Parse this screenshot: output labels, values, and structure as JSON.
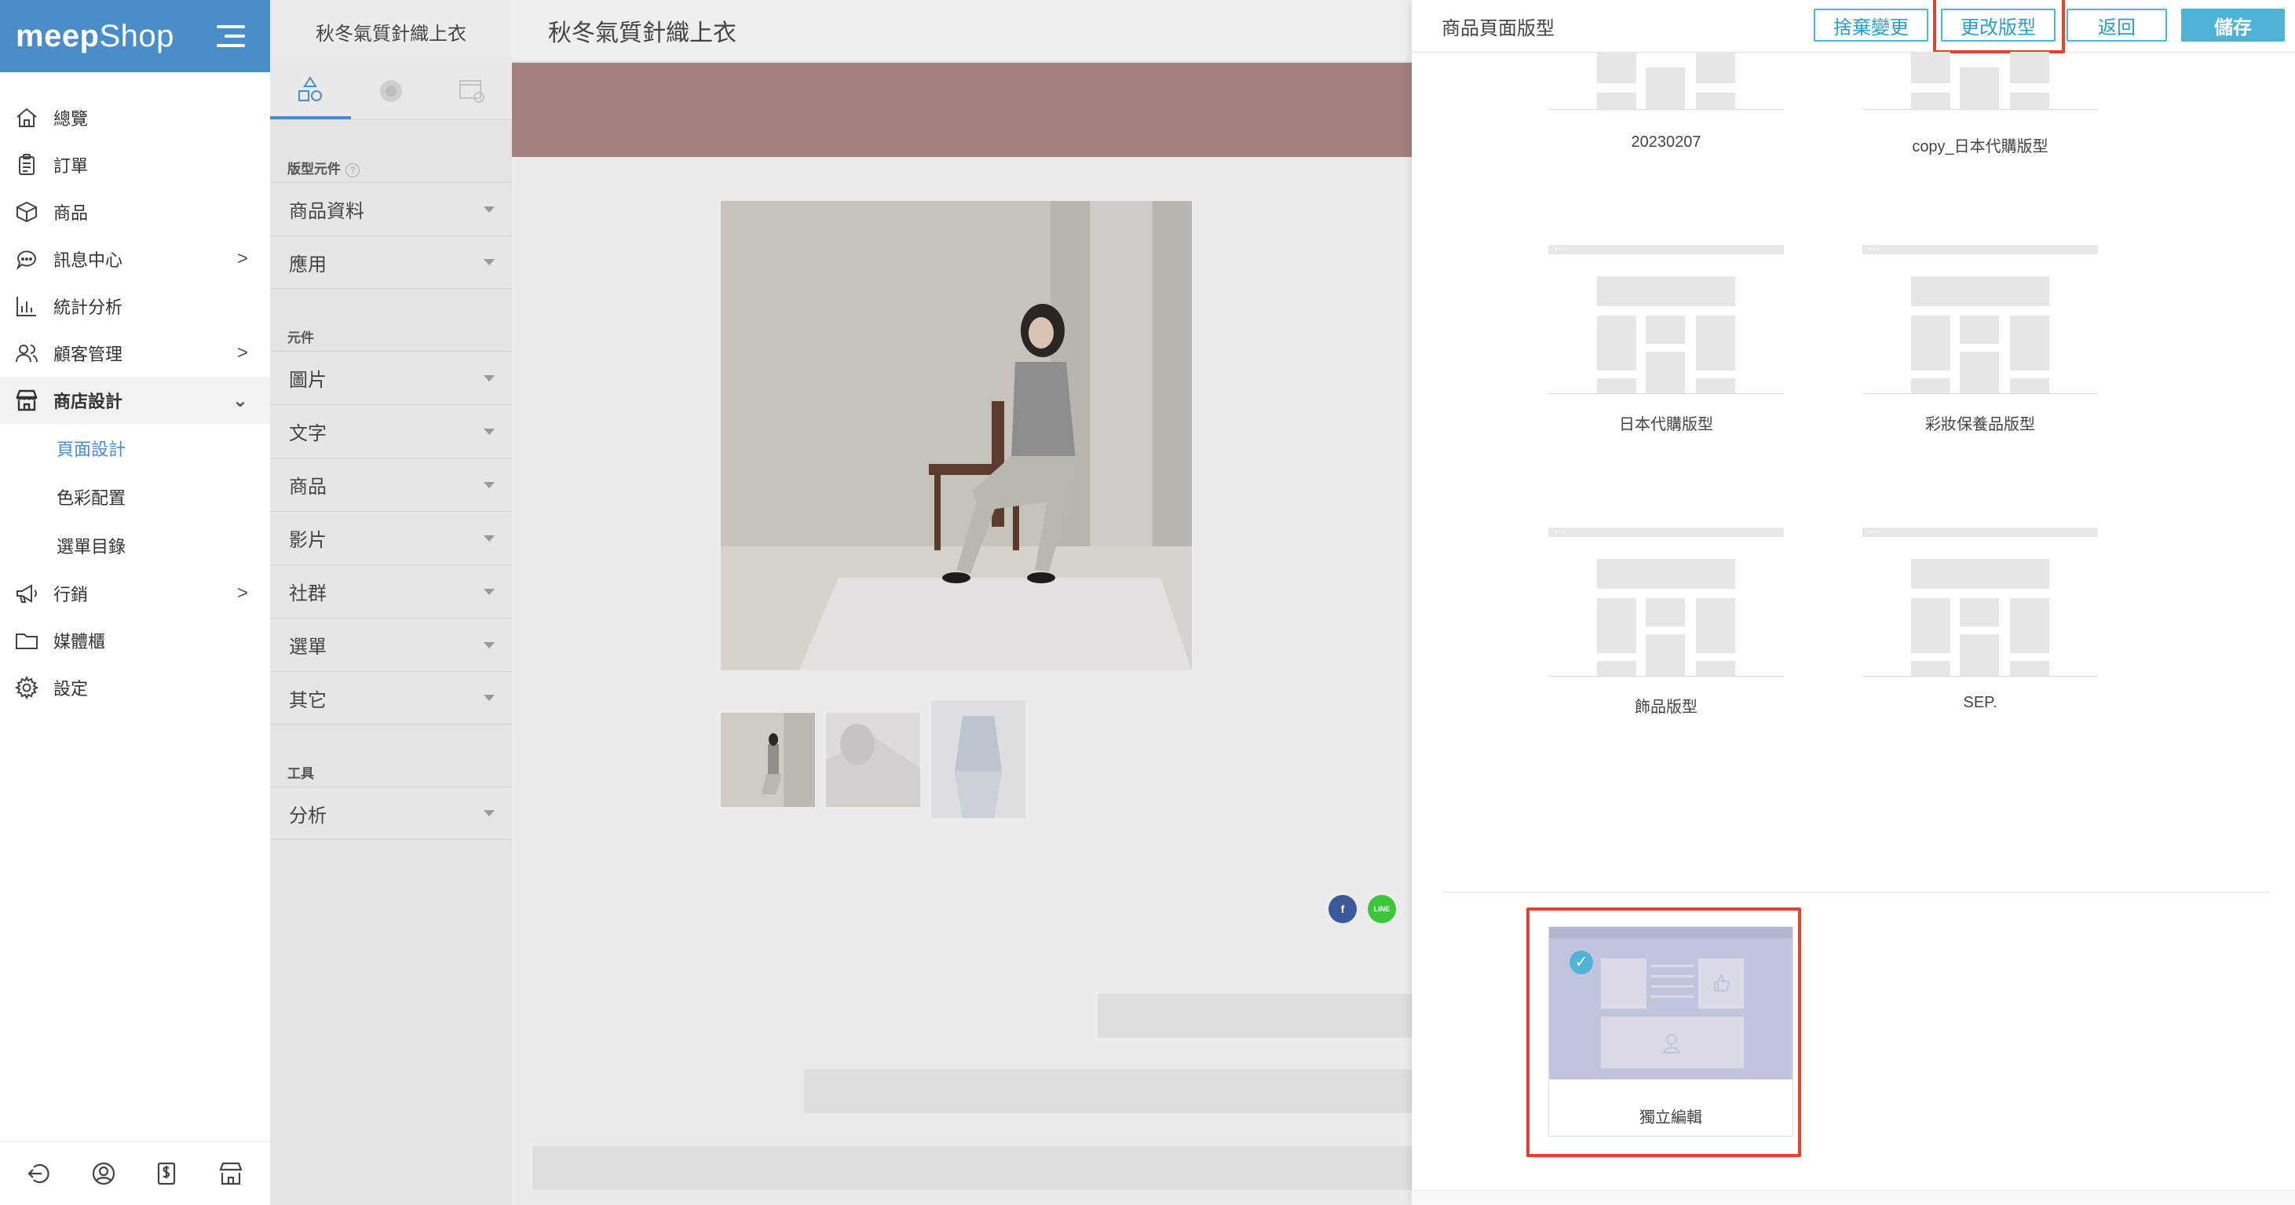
{
  "app": {
    "logo_bold": "meep",
    "logo_light": "Shop"
  },
  "sidebar": {
    "items": [
      {
        "label": "總覽",
        "icon": "home-icon"
      },
      {
        "label": "訂單",
        "icon": "clipboard-icon"
      },
      {
        "label": "商品",
        "icon": "box-icon"
      },
      {
        "label": "訊息中心",
        "icon": "chat-icon",
        "chevron": ">"
      },
      {
        "label": "統計分析",
        "icon": "bar-chart-icon"
      },
      {
        "label": "顧客管理",
        "icon": "users-icon",
        "chevron": ">"
      },
      {
        "label": "商店設計",
        "icon": "store-icon",
        "chevron": "⌄"
      },
      {
        "label": "行銷",
        "icon": "megaphone-icon",
        "chevron": ">"
      },
      {
        "label": "媒體櫃",
        "icon": "folder-icon"
      },
      {
        "label": "設定",
        "icon": "gear-icon"
      }
    ],
    "subitems": [
      "頁面設計",
      "色彩配置",
      "選單目錄"
    ]
  },
  "editor": {
    "title": "秋冬氣質針織上衣",
    "section_layout": "版型元件",
    "layout_items": [
      "商品資料",
      "應用"
    ],
    "section_components": "元件",
    "component_items": [
      "圖片",
      "文字",
      "商品",
      "影片",
      "社群",
      "選單",
      "其它"
    ],
    "section_tools": "工具",
    "tool_items": [
      "分析"
    ]
  },
  "preview": {
    "title": "秋冬氣質針織上衣",
    "banner_color": "#a48080",
    "share": {
      "facebook": "f",
      "line": "LINE"
    }
  },
  "drawer": {
    "title": "商品頁面版型",
    "buttons": {
      "discard": "捨棄變更",
      "change": "更改版型",
      "back": "返回",
      "save": "儲存"
    },
    "templates": [
      "20230207",
      "copy_日本代購版型",
      "日本代購版型",
      "彩妝保養品版型",
      "飾品版型",
      "SEP."
    ],
    "selected_template": "獨立編輯",
    "accent_color": "#4fb3d6",
    "highlight_color": "#e0432f"
  }
}
